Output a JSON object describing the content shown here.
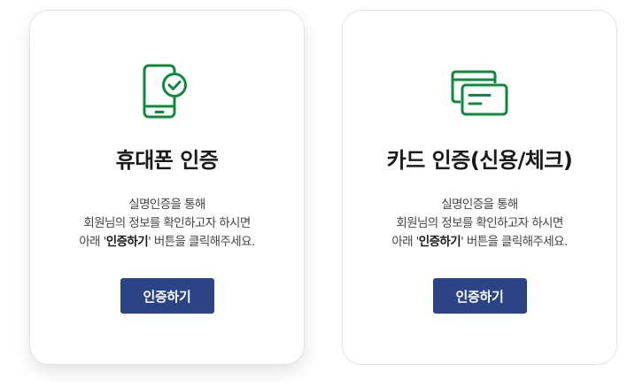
{
  "colors": {
    "accent_green": "#0f8a3c",
    "button_navy": "#2b4486"
  },
  "cards": [
    {
      "icon": "phone-check-icon",
      "title": "휴대폰 인증",
      "desc_line1": "실명인증을 통해",
      "desc_line2": "회원님의 정보를 확인하고자 하시면",
      "desc_line3_prefix": "아래 '",
      "desc_line3_bold": "인증하기",
      "desc_line3_suffix": "' 버튼을 클릭해주세요.",
      "button_label": "인증하기"
    },
    {
      "icon": "credit-card-icon",
      "title": "카드 인증(신용/체크)",
      "desc_line1": "실명인증을 통해",
      "desc_line2": "회원님의 정보를 확인하고자 하시면",
      "desc_line3_prefix": "아래 '",
      "desc_line3_bold": "인증하기",
      "desc_line3_suffix": "' 버튼을 클릭해주세요.",
      "button_label": "인증하기"
    }
  ]
}
